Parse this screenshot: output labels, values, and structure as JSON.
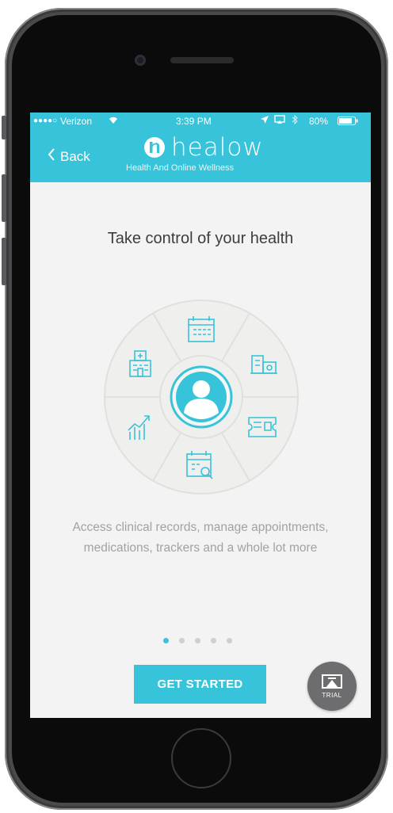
{
  "status_bar": {
    "signal": "●●●●○",
    "carrier": "Verizon",
    "wifi_icon": "wifi-icon",
    "time": "3:39 PM",
    "battery": "80%"
  },
  "nav": {
    "back_label": "Back",
    "logo_text": "healow",
    "tagline": "Health And Online Wellness"
  },
  "main": {
    "headline": "Take control of your health",
    "description_line1": "Access clinical records, manage appointments,",
    "description_line2": "medications, trackers and a whole lot more",
    "wheel_icons": [
      "calendar-icon",
      "pharmacy-icon",
      "card-icon",
      "appointment-search-icon",
      "trend-chart-icon",
      "hospital-icon"
    ],
    "center_icon": "user-avatar-icon"
  },
  "pager": {
    "page_count": 5,
    "current_page": 1
  },
  "actions": {
    "get_started_label": "GET STARTED",
    "trial_label": "TRIAL"
  },
  "colors": {
    "accent": "#37c3d9",
    "background": "#f3f3f3",
    "trial_button": "#6d6d6f"
  }
}
